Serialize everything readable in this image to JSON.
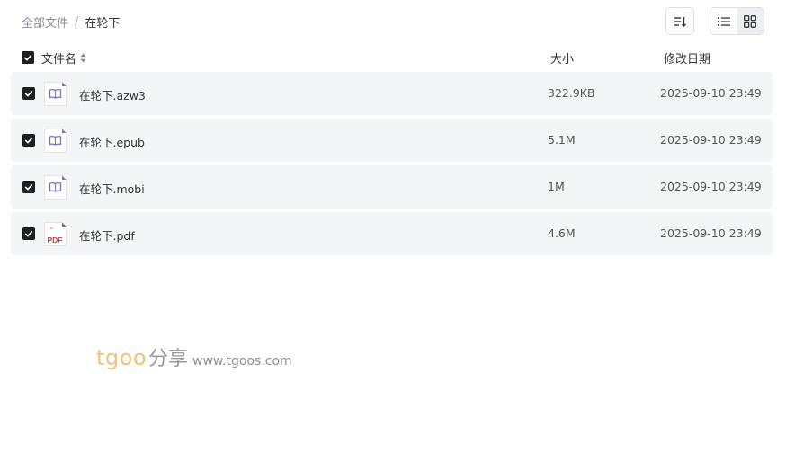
{
  "breadcrumb": {
    "root": "全部文件",
    "separator": "/",
    "current": "在轮下"
  },
  "toolbar": {
    "sort_icon": "sort-icon",
    "list_view_icon": "list-view-icon",
    "grid_view_icon": "grid-view-icon"
  },
  "table": {
    "headers": {
      "name": "文件名",
      "size": "大小",
      "date": "修改日期"
    },
    "rows": [
      {
        "name": "在轮下.azw3",
        "size": "322.9KB",
        "date": "2025-09-10 23:49",
        "icon": "ebook-icon"
      },
      {
        "name": "在轮下.epub",
        "size": "5.1M",
        "date": "2025-09-10 23:49",
        "icon": "ebook-icon"
      },
      {
        "name": "在轮下.mobi",
        "size": "1M",
        "date": "2025-09-10 23:49",
        "icon": "ebook-icon"
      },
      {
        "name": "在轮下.pdf",
        "size": "4.6M",
        "date": "2025-09-10 23:49",
        "icon": "pdf-icon"
      }
    ]
  },
  "pdf_icon_text": "PDF",
  "watermark": {
    "brand": "tgoo",
    "share": "分享",
    "url": "www.tgoos.com"
  },
  "colors": {
    "row_bg": "#f4f5f7",
    "checkbox": "#1f1f1f",
    "ebook_icon": "#7b6fd6",
    "pdf_icon": "#e03a3a"
  }
}
